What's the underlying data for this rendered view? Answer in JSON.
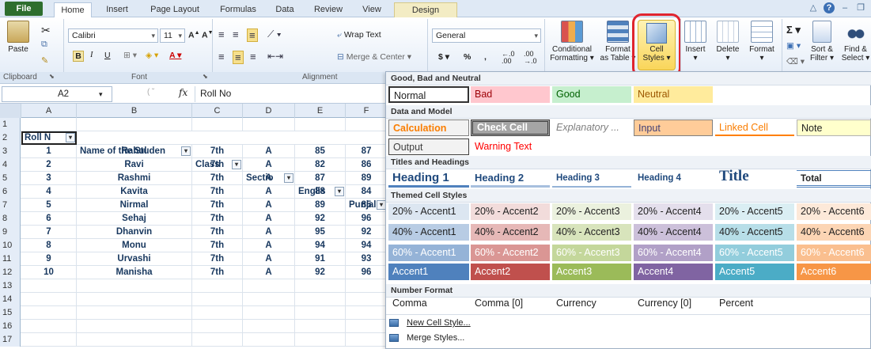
{
  "ribbon_tabs": [
    "File",
    "Home",
    "Insert",
    "Page Layout",
    "Formulas",
    "Data",
    "Review",
    "View",
    "Design"
  ],
  "ribbon": {
    "clipboard": {
      "paste": "Paste",
      "group_label": "Clipboard"
    },
    "font": {
      "name": "Calibri",
      "size": "11",
      "group_label": "Font",
      "bold": "B",
      "italic": "I",
      "underline": "U"
    },
    "alignment": {
      "wrap_text": "Wrap Text",
      "merge_center": "Merge & Center",
      "group_label": "Alignment"
    },
    "number": {
      "format": "General",
      "currency": "$",
      "percent": "%",
      "comma": ","
    },
    "styles": {
      "conditional": "Conditional",
      "conditional2": "Formatting",
      "format_as": "Format",
      "format_as2": "as Table",
      "cell_styles": "Cell",
      "cell_styles2": "Styles"
    },
    "cells": {
      "insert": "Insert",
      "delete": "Delete",
      "format": "Format"
    },
    "editing": {
      "sort": "Sort &",
      "sort2": "Filter",
      "find": "Find &",
      "find2": "Select",
      "sigma": "Σ"
    }
  },
  "formula_bar": {
    "name_box": "A2",
    "fx": "fx",
    "content": "Roll No"
  },
  "columns": [
    "A",
    "B",
    "C",
    "D",
    "E",
    "F"
  ],
  "row_numbers": [
    "1",
    "2",
    "3",
    "4",
    "5",
    "6",
    "7",
    "8",
    "9",
    "10",
    "11",
    "12",
    "13",
    "14",
    "15",
    "16",
    "17"
  ],
  "table_headers": [
    "Roll N",
    "Name of the Studen",
    "Class",
    "Sectio",
    "Englis",
    "Punjal"
  ],
  "table_rows": [
    [
      "1",
      "Rahul",
      "7th",
      "A",
      "85",
      "87"
    ],
    [
      "2",
      "Ravi",
      "7th",
      "A",
      "82",
      "86"
    ],
    [
      "3",
      "Rashmi",
      "7th",
      "A",
      "87",
      "89"
    ],
    [
      "4",
      "Kavita",
      "7th",
      "A",
      "88",
      "84"
    ],
    [
      "5",
      "Nirmal",
      "7th",
      "A",
      "89",
      "85"
    ],
    [
      "6",
      "Sehaj",
      "7th",
      "A",
      "92",
      "96"
    ],
    [
      "7",
      "Dhanvin",
      "7th",
      "A",
      "95",
      "92"
    ],
    [
      "8",
      "Monu",
      "7th",
      "A",
      "94",
      "94"
    ],
    [
      "9",
      "Urvashi",
      "7th",
      "A",
      "91",
      "93"
    ],
    [
      "10",
      "Manisha",
      "7th",
      "A",
      "92",
      "96"
    ]
  ],
  "gallery": {
    "sections": {
      "good_bad": "Good, Bad and Neutral",
      "data_model": "Data and Model",
      "titles": "Titles and Headings",
      "themed": "Themed Cell Styles",
      "number": "Number Format"
    },
    "good_bad": [
      "Normal",
      "Bad",
      "Good",
      "Neutral"
    ],
    "data_model_row1": [
      "Calculation",
      "Check Cell",
      "Explanatory ...",
      "Input",
      "Linked Cell",
      "Note"
    ],
    "data_model_row2": [
      "Output",
      "Warning Text"
    ],
    "titles": [
      "Heading 1",
      "Heading 2",
      "Heading 3",
      "Heading 4",
      "Title",
      "Total"
    ],
    "accent20": [
      "20% - Accent1",
      "20% - Accent2",
      "20% - Accent3",
      "20% - Accent4",
      "20% - Accent5",
      "20% - Accent6"
    ],
    "accent40": [
      "40% - Accent1",
      "40% - Accent2",
      "40% - Accent3",
      "40% - Accent4",
      "40% - Accent5",
      "40% - Accent6"
    ],
    "accent60": [
      "60% - Accent1",
      "60% - Accent2",
      "60% - Accent3",
      "60% - Accent4",
      "60% - Accent5",
      "60% - Accent6"
    ],
    "accent": [
      "Accent1",
      "Accent2",
      "Accent3",
      "Accent4",
      "Accent5",
      "Accent6"
    ],
    "number_formats": [
      "Comma",
      "Comma [0]",
      "Currency",
      "Currency [0]",
      "Percent"
    ],
    "menu": [
      "New Cell Style...",
      "Merge Styles..."
    ]
  },
  "colors": {
    "accent20": [
      "#dce6f1",
      "#f2dcdb",
      "#ebf1de",
      "#e4dfec",
      "#daeef3",
      "#fde9d9"
    ],
    "accent40": [
      "#b8cce4",
      "#e6b8b7",
      "#d8e4bc",
      "#ccc0da",
      "#b7dee8",
      "#fcd5b4"
    ],
    "accent60": [
      "#95b3d7",
      "#da9694",
      "#c4d79b",
      "#b1a0c7",
      "#92cddc",
      "#fabf8f"
    ],
    "accent": [
      "#4f81bd",
      "#c0504d",
      "#9bbb59",
      "#8064a2",
      "#4bacc6",
      "#f79646"
    ]
  }
}
